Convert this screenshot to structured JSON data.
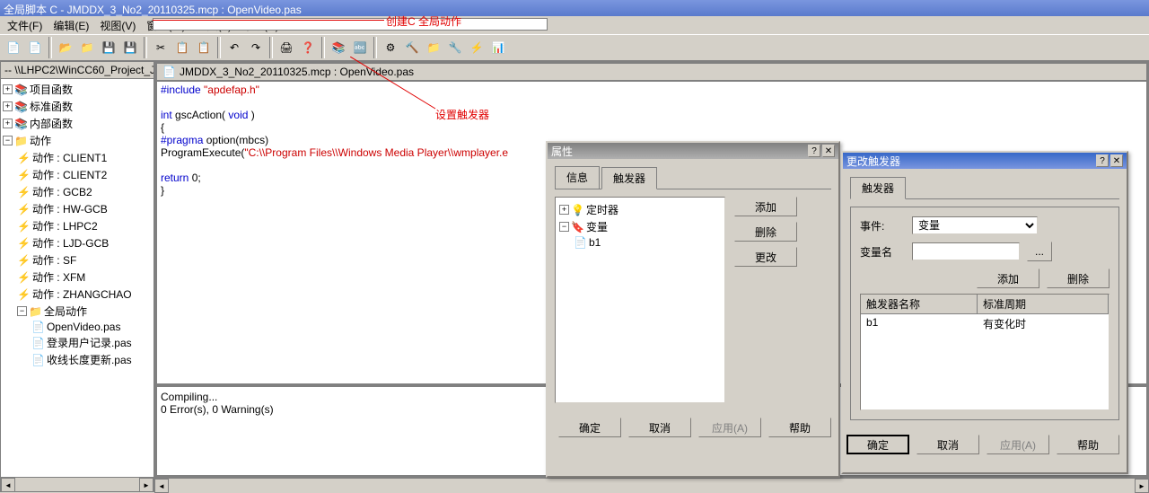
{
  "titlebar": "全局脚本 C - JMDDX_3_No2_20110325.mcp : OpenVideo.pas",
  "menu": {
    "file": "文件(F)",
    "edit": "编辑(E)",
    "view": "视图(V)",
    "window": "窗口(W)",
    "tools": "工具(T)",
    "help": "帮助(H)"
  },
  "annotation1": "创建C 全局动作",
  "annotation2": "设置触发器",
  "sidebar_header": "-- \\\\LHPC2\\WinCC60_Project_JMDD",
  "tree": {
    "root1": "项目函数",
    "root2": "标准函数",
    "root3": "内部函数",
    "root4": "动作",
    "actions": [
      "动作 : CLIENT1",
      "动作 : CLIENT2",
      "动作 : GCB2",
      "动作 : HW-GCB",
      "动作 : LHPC2",
      "动作 : LJD-GCB",
      "动作 : SF",
      "动作 : XFM",
      "动作 : ZHANGCHAO"
    ],
    "global": "全局动作",
    "files": [
      "OpenVideo.pas",
      "登录用户记录.pas",
      "收线长度更新.pas"
    ]
  },
  "editor_tab": "JMDDX_3_No2_20110325.mcp : OpenVideo.pas",
  "code": {
    "l1a": "#include",
    "l1b": " \"apdefap.h\"",
    "l2a": "int",
    "l2b": " gscAction( ",
    "l2c": "void",
    "l2d": " )",
    "l3": "{",
    "l4a": "#pragma",
    "l4b": " option(mbcs)",
    "l5a": "ProgramExecute(",
    "l5b": "\"C:\\\\Program Files\\\\Windows Media Player\\\\wmplayer.e",
    "l6a": "return",
    "l6b": " 0;",
    "l7": "}"
  },
  "output": {
    "l1": "Compiling...",
    "l2": "0 Error(s), 0 Warning(s)"
  },
  "dlg1": {
    "title": "属性",
    "tab1": "信息",
    "tab2": "触发器",
    "tree_timer": "定时器",
    "tree_var": "变量",
    "tree_b1": "b1",
    "btn_add": "添加",
    "btn_del": "删除",
    "btn_mod": "更改",
    "btn_ok": "确定",
    "btn_cancel": "取消",
    "btn_apply": "应用(A)",
    "btn_help": "帮助"
  },
  "dlg2": {
    "title": "更改触发器",
    "tab": "触发器",
    "lbl_event": "事件:",
    "sel_event": "变量",
    "lbl_varname": "变量名",
    "btn_browse": "...",
    "btn_add": "添加",
    "btn_del": "删除",
    "col1": "触发器名称",
    "col2": "标准周期",
    "row_name": "b1",
    "row_cycle": "有变化时",
    "btn_ok": "确定",
    "btn_cancel": "取消",
    "btn_apply": "应用(A)",
    "btn_help": "帮助"
  }
}
